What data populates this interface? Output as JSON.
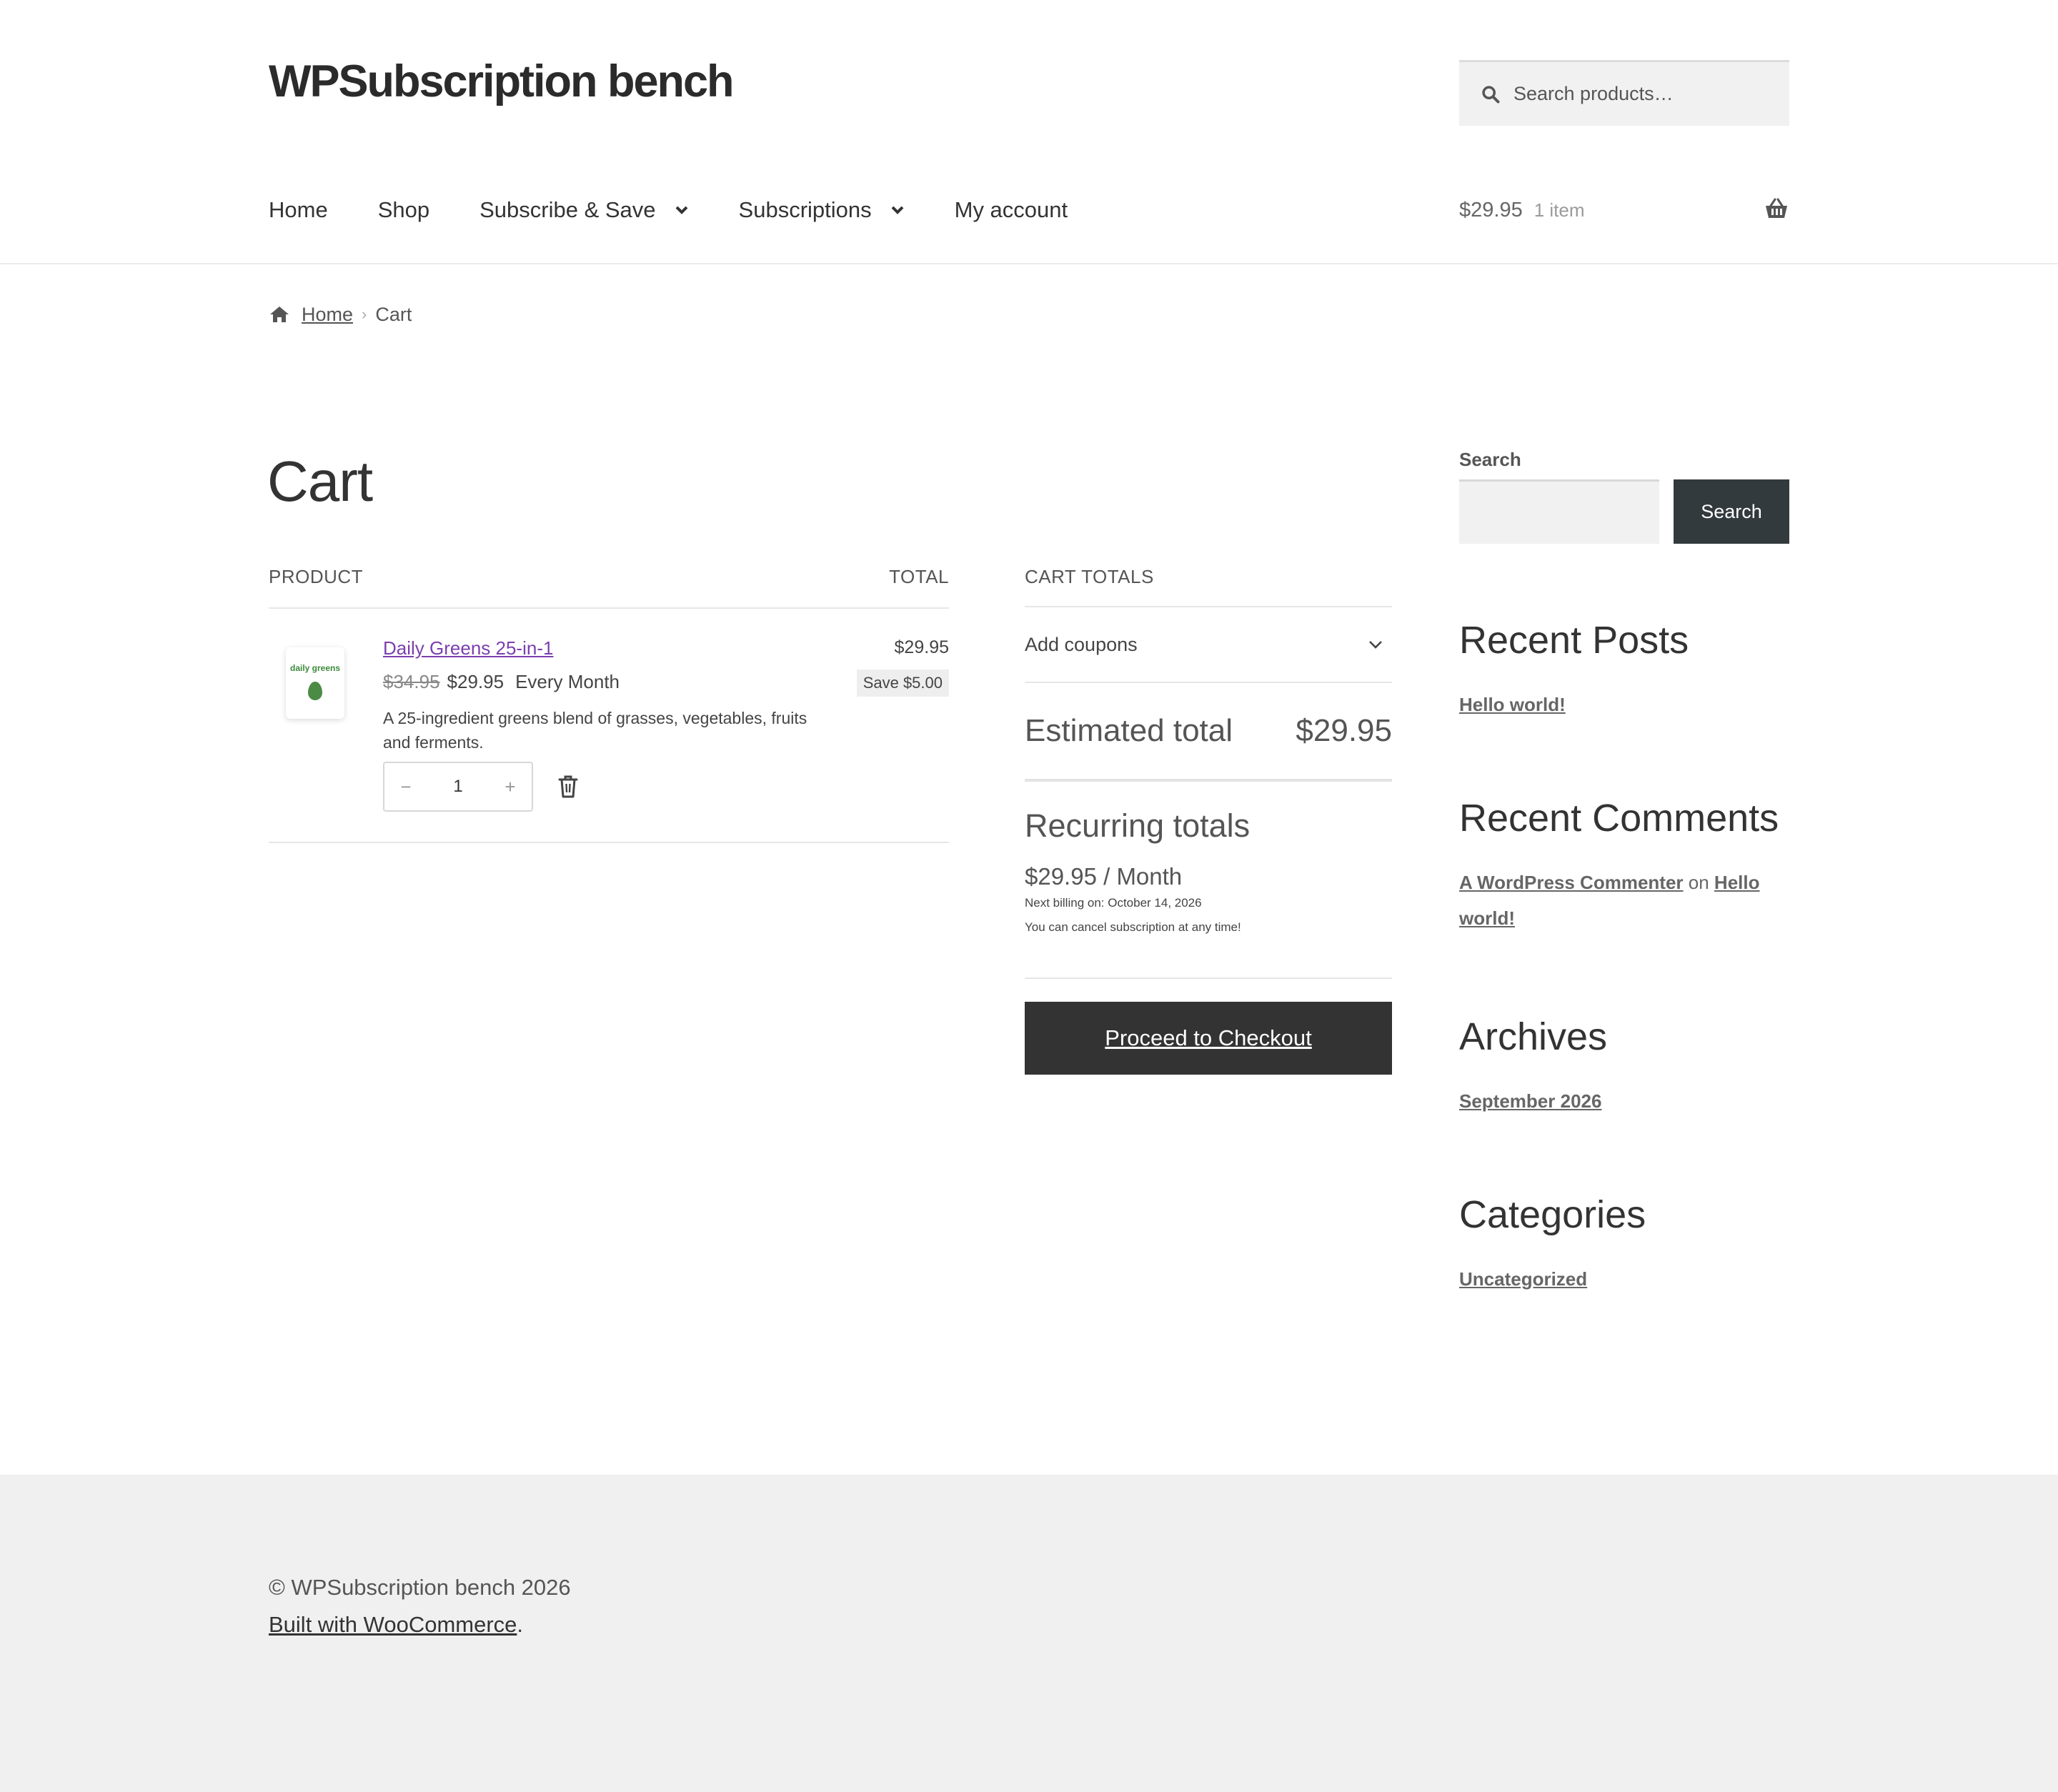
{
  "site": {
    "title": "WPSubscription bench"
  },
  "header_search": {
    "placeholder": "Search products…"
  },
  "nav": {
    "items": [
      {
        "label": "Home",
        "has_dropdown": false
      },
      {
        "label": "Shop",
        "has_dropdown": false
      },
      {
        "label": "Subscribe & Save",
        "has_dropdown": true
      },
      {
        "label": "Subscriptions",
        "has_dropdown": true
      },
      {
        "label": "My account",
        "has_dropdown": false
      }
    ]
  },
  "header_cart": {
    "amount": "$29.95",
    "count": "1 item"
  },
  "breadcrumb": {
    "home": "Home",
    "current": "Cart"
  },
  "page": {
    "title": "Cart"
  },
  "cart_table": {
    "col_product": "PRODUCT",
    "col_total": "TOTAL",
    "item": {
      "name": "Daily Greens 25-in-1",
      "thumb_label": "daily greens",
      "thumb_sub": "",
      "old_price": "$34.95",
      "price": "$29.95",
      "period": "Every Month",
      "description": "A 25-ingredient greens blend of grasses, vegetables, fruits and ferments.",
      "quantity": "1",
      "qty_minus": "−",
      "qty_plus": "+",
      "line_total": "$29.95",
      "save_badge": "Save $5.00"
    }
  },
  "totals": {
    "heading": "CART TOTALS",
    "coupon_label": "Add coupons",
    "estimated_label": "Estimated total",
    "estimated_value": "$29.95",
    "recurring_title": "Recurring totals",
    "recurring_price": "$29.95 / Month",
    "next_billing": "Next billing on: October 14, 2026",
    "cancel_note": "You can cancel subscription at any time!",
    "checkout_label": "Proceed to Checkout"
  },
  "sidebar": {
    "search_label": "Search",
    "search_button": "Search",
    "recent_posts_title": "Recent Posts",
    "recent_post": "Hello world!",
    "recent_comments_title": "Recent Comments",
    "comment_author": "A WordPress Commenter",
    "comment_on": "on",
    "comment_post": "Hello world!",
    "archives_title": "Archives",
    "archive_item": "September 2026",
    "categories_title": "Categories",
    "category_item": "Uncategorized"
  },
  "footer": {
    "copyright": "© WPSubscription bench 2026",
    "built_with": "Built with WooCommerce",
    "built_suffix": "."
  },
  "colors": {
    "accent_link": "#7b3fae",
    "button_dark": "#333333",
    "footer_bg": "#f0f0f0"
  }
}
